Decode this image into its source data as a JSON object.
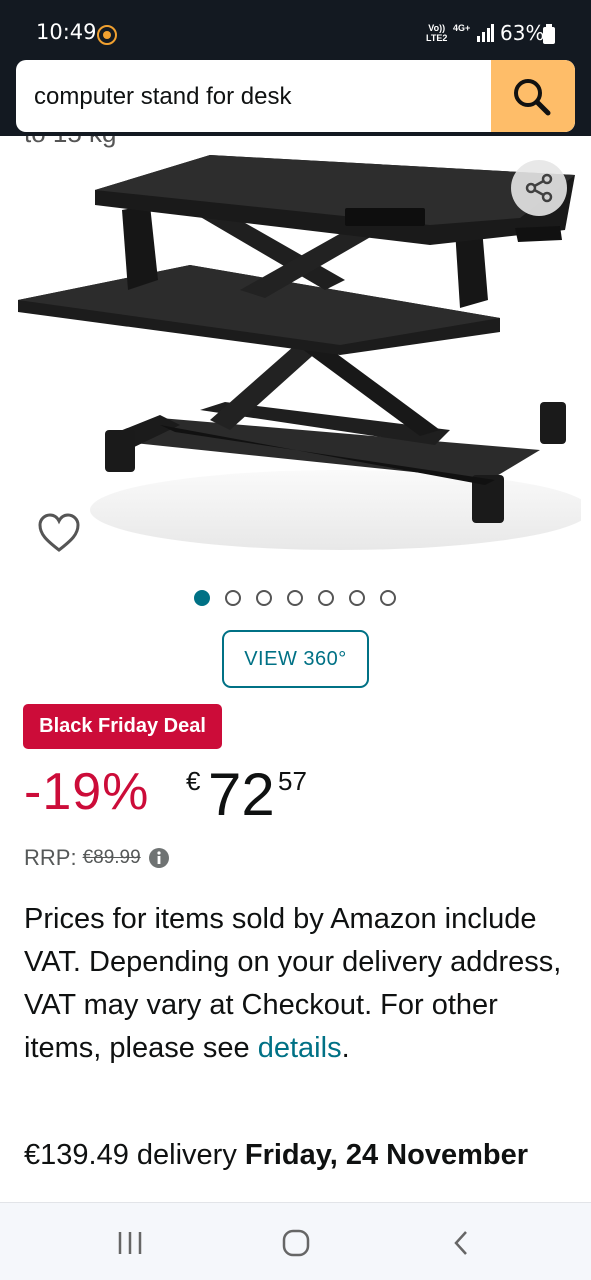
{
  "status_bar": {
    "time": "10:49",
    "network_top": "Vo))",
    "network_bottom": "LTE2",
    "network_type": "4G+",
    "battery": "63%"
  },
  "search": {
    "query": "computer stand for desk",
    "icon": "search-icon"
  },
  "product": {
    "cut_off_text": "to 15 kg",
    "image_count": 7,
    "active_image": 1,
    "view_360_label": "VIEW 360°",
    "deal_badge": "Black Friday Deal",
    "discount": "-19%",
    "price_symbol": "€",
    "price_whole": "72",
    "price_fraction": "57",
    "rrp_label": "RRP:",
    "rrp_value": "€89.99",
    "vat_text": "Prices for items sold by Amazon include VAT. Depending on your delivery address, VAT may vary at Checkout. For other items, please see ",
    "vat_link": "details",
    "vat_end": ".",
    "delivery_prefix": "€139.49 delivery ",
    "delivery_date": "Friday, 24 November"
  },
  "colors": {
    "header": "#131921",
    "search_button": "#febd69",
    "deal": "#cc0c39",
    "link": "#007185"
  }
}
